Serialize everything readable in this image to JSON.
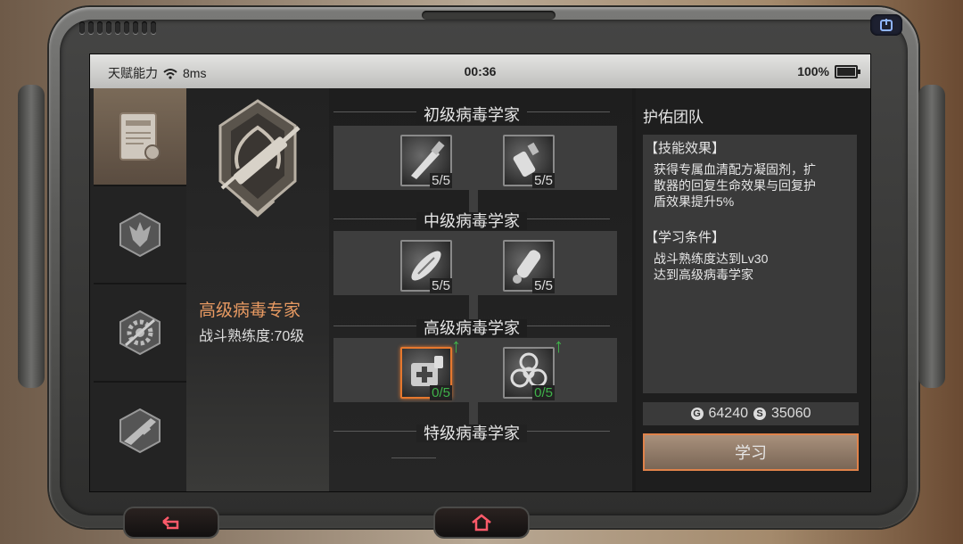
{
  "status": {
    "carrier": "天赋能力",
    "ping": "8ms",
    "time": "00:36",
    "battery": "100%"
  },
  "tabs": [
    {
      "icon": "certificate-icon",
      "active": true
    },
    {
      "icon": "wolf-emblem-icon",
      "active": false
    },
    {
      "icon": "gear-tools-icon",
      "active": false
    },
    {
      "icon": "rifle-emblem-icon",
      "active": false
    }
  ],
  "profile": {
    "emblem": "syringe-emblem-icon",
    "name": "高级病毒专家",
    "level": "战斗熟练度:70级"
  },
  "tiers": [
    {
      "title": "初级病毒学家",
      "skills": [
        {
          "icon": "injector-icon",
          "count": "5/5"
        },
        {
          "icon": "spray-bottle-icon",
          "count": "5/5"
        }
      ]
    },
    {
      "title": "中级病毒学家",
      "skills": [
        {
          "icon": "capsule-icon",
          "count": "5/5"
        },
        {
          "icon": "vial-icon",
          "count": "5/5"
        }
      ]
    },
    {
      "title": "高级病毒学家",
      "skills": [
        {
          "icon": "medkit-icon",
          "count": "0/5"
        },
        {
          "icon": "biohazard-icon",
          "count": "0/5"
        }
      ]
    },
    {
      "title": "特级病毒学家",
      "skills": []
    }
  ],
  "detail": {
    "title": "护佑团队",
    "effect_header": "【技能效果】",
    "effect_lines": [
      "获得专属血清配方凝固剂，扩",
      "散器的回复生命效果与回复护",
      "盾效果提升5%"
    ],
    "req_header": "【学习条件】",
    "req_lines": [
      "战斗熟练度达到Lv30",
      "达到高级病毒学家"
    ],
    "cost_gold": "64240",
    "cost_silver": "35060",
    "learn_label": "学习"
  },
  "colors": {
    "accent": "#e6782e",
    "name_orange": "#e89a62",
    "upgrade_green": "#3fb34a"
  }
}
